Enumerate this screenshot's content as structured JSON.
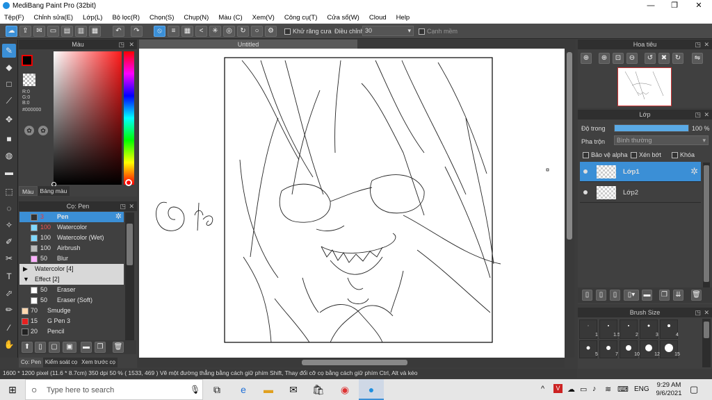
{
  "app": {
    "title": "MediBang Paint Pro (32bit)"
  },
  "window_controls": {
    "minimize": "—",
    "maximize": "❐",
    "close": "✕"
  },
  "menu": [
    "Tệp(F)",
    "Chỉnh sửa(E)",
    "Lớp(L)",
    "Bộ lọc(R)",
    "Chọn(S)",
    "Chụp(N)",
    "Màu (C)",
    "Xem(V)",
    "Công cụ(T)",
    "Cửa sổ(W)",
    "Cloud",
    "Help"
  ],
  "toolbar": {
    "antialias_label": "Khử răng cưa",
    "adjust_label": "Điều chỉnh",
    "adjust_value": "30",
    "edge_label": "Cạnh mềm"
  },
  "color_panel": {
    "title": "Màu",
    "rgb": [
      "R:0",
      "G:0",
      "B:0"
    ],
    "hex": "#000000",
    "tabs": [
      "Màu",
      "Bảng màu"
    ],
    "colors": {
      "primary": "#000000",
      "accent": "#3b8fd6"
    }
  },
  "brush_panel": {
    "title": "Cọ: Pen",
    "items": [
      {
        "size": "3",
        "name": "Pen",
        "color": "#333333",
        "selected": true
      },
      {
        "size": "100",
        "name": "Watercolor",
        "color": "#7fd8ff"
      },
      {
        "size": "100",
        "name": "Watercolor (Wet)",
        "color": "#7fd8ff"
      },
      {
        "size": "100",
        "name": "Airbrush",
        "color": "#bbbbbb"
      },
      {
        "size": "50",
        "name": "Blur",
        "color": "#ffb0ff"
      }
    ],
    "groups": [
      {
        "arrow": "▶",
        "name": "Watercolor [4]"
      },
      {
        "arrow": "▼",
        "name": "Effect [2]"
      }
    ],
    "effect_items": [
      {
        "size": "50",
        "name": "Eraser",
        "color": "#ffffff"
      },
      {
        "size": "50",
        "name": "Eraser (Soft)",
        "color": "#ffffff"
      }
    ],
    "more_items": [
      {
        "size": "70",
        "name": "Smudge",
        "color": "#ffd8b0"
      },
      {
        "size": "15",
        "name": "G Pen 3",
        "color": "#e82020"
      },
      {
        "size": "20",
        "name": "Pencil",
        "color": "#222222"
      }
    ],
    "bottom_tabs": [
      "Cọ: Pen",
      "Kiểm soát cọ",
      "Xem trước cọ"
    ]
  },
  "canvas": {
    "tab_title": "Untitled"
  },
  "navigator": {
    "title": "Hoa tiêu"
  },
  "layer_panel": {
    "title": "Lớp",
    "opacity_label": "Độ trong",
    "opacity_value": "100 %",
    "opacity_fraction": 1.0,
    "blend_label": "Pha trộn",
    "blend_value": "Bình thường",
    "protect_alpha": "Bảo vệ alpha",
    "clipping": "Xén bớt",
    "lock": "Khóa",
    "layers": [
      {
        "name": "Lớp1",
        "selected": true
      },
      {
        "name": "Lớp2",
        "selected": false
      }
    ]
  },
  "brush_size": {
    "title": "Brush Size",
    "row1": [
      "1",
      "1.5",
      "2",
      "3",
      "4"
    ],
    "row2": [
      "5",
      "7",
      "10",
      "12",
      "15"
    ]
  },
  "status": {
    "dims": "1600 * 1200 pixel",
    "physical": "(11.6 * 8.7cm)",
    "dpi": "350 dpi",
    "zoom": "50 %",
    "coords": "( 1533, 469 )",
    "hint": "Vẽ một đường thẳng bằng cách giữ phím Shift, Thay đổi cỡ cọ bằng cách giữ phím Ctrl, Alt và kéo"
  },
  "taskbar": {
    "search_placeholder": "Type here to search",
    "lang": "ENG",
    "time": "9:29 AM",
    "date": "9/6/2021"
  }
}
